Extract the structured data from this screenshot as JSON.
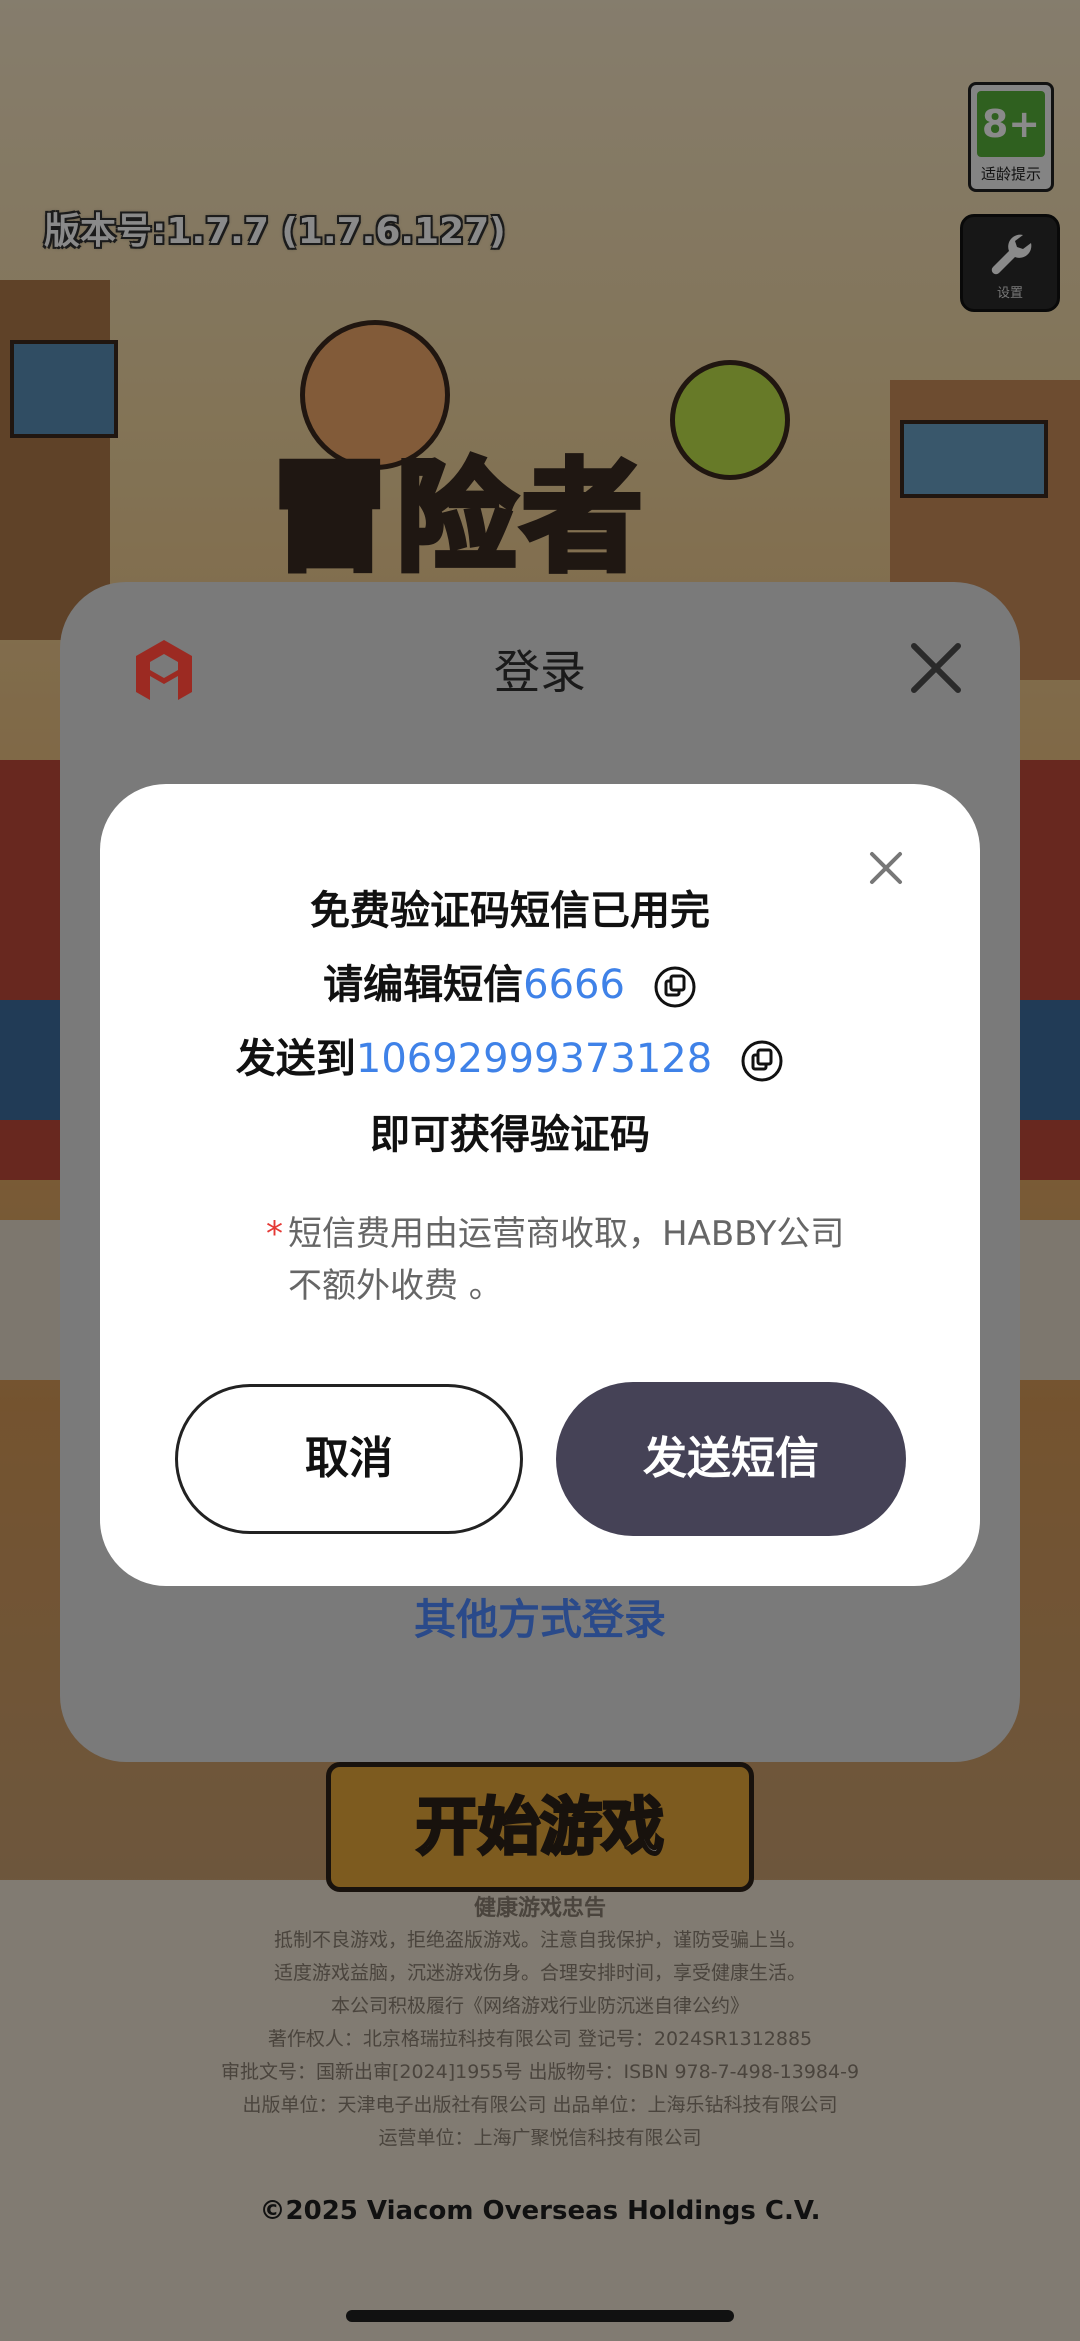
{
  "background": {
    "age_rating": {
      "value": "8+",
      "label": "适龄提示"
    },
    "settings_label": "设置",
    "version": "版本号:1.7.7 (1.7.6.127)",
    "game_logo_text": "冒险者",
    "start_button": "开始游戏",
    "footer": {
      "title": "健康游戏忠告",
      "lines": [
        "抵制不良游戏，拒绝盗版游戏。注意自我保护，谨防受骗上当。",
        "适度游戏益脑，沉迷游戏伤身。合理安排时间，享受健康生活。",
        "本公司积极履行《网络游戏行业防沉迷自律公约》",
        "著作权人：北京格瑞拉科技有限公司 登记号：2024SR1312885",
        "审批文号：国新出审[2024]1955号 出版物号：ISBN 978-7-498-13984-9",
        "出版单位：天津电子出版社有限公司 出品单位：上海乐钻科技有限公司",
        "运营单位：上海广聚悦信科技有限公司"
      ],
      "copyright": "©2025 Viacom Overseas Holdings C.V."
    }
  },
  "login": {
    "title": "登录",
    "other_methods": "其他方式登录"
  },
  "dialog": {
    "line1": "免费验证码短信已用完",
    "line2_prefix": "请编辑短信",
    "sms_code": "6666",
    "line3_prefix": "发送到",
    "phone_number": "10692999373128",
    "line4": "即可获得验证码",
    "note_star": "*",
    "note": "短信费用由运营商收取，HABBY公司不额外收费 。",
    "cancel_label": "取消",
    "send_label": "发送短信"
  },
  "colors": {
    "accent_blue": "#3f82e8",
    "send_button": "#454256",
    "required_red": "#e53935",
    "brand_red": "#d23a2c"
  }
}
